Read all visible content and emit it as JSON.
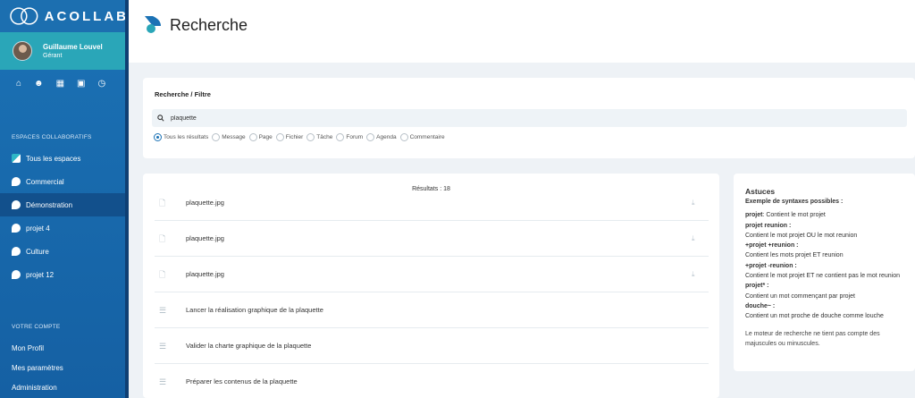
{
  "sidebar": {
    "brand": "ACOLLAB",
    "user": {
      "name": "Guillaume Louvel",
      "role": "Gérant"
    },
    "quick_icons": [
      "home-icon",
      "users-icon",
      "calendar-icon",
      "briefcase-icon",
      "clock-icon"
    ],
    "spaces_title": "ESPACES COLLABORATIFS",
    "spaces": [
      {
        "label": "Tous les espaces",
        "icon": "spaces-icon"
      },
      {
        "label": "Commercial",
        "icon": "space-icon"
      },
      {
        "label": "Démonstration",
        "icon": "space-icon",
        "active": true
      },
      {
        "label": "projet 4",
        "icon": "space-icon"
      },
      {
        "label": "Culture",
        "icon": "space-icon"
      },
      {
        "label": "projet 12",
        "icon": "space-icon"
      }
    ],
    "account_title": "VOTRE COMPTE",
    "account": [
      {
        "label": "Mon Profil"
      },
      {
        "label": "Mes paramètres"
      },
      {
        "label": "Administration"
      }
    ]
  },
  "header": {
    "title": "Recherche"
  },
  "search": {
    "title": "Recherche / Filtre",
    "value": "plaquette",
    "filters": [
      {
        "label": "Tous les résultats",
        "selected": true
      },
      {
        "label": "Message"
      },
      {
        "label": "Page"
      },
      {
        "label": "Fichier"
      },
      {
        "label": "Tâche"
      },
      {
        "label": "Forum"
      },
      {
        "label": "Agenda"
      },
      {
        "label": "Commentaire"
      }
    ]
  },
  "results": {
    "count_text": "Résultats : 18",
    "items": [
      {
        "label": "plaquette.jpg",
        "type": "file"
      },
      {
        "label": "plaquette.jpg",
        "type": "file"
      },
      {
        "label": "plaquette.jpg",
        "type": "file"
      },
      {
        "label": "Lancer la réalisation graphique de la plaquette",
        "type": "task"
      },
      {
        "label": "Valider la charte graphique de la plaquette",
        "type": "task"
      },
      {
        "label": "Préparer les contenus de la plaquette",
        "type": "task"
      }
    ]
  },
  "tips": {
    "title": "Astuces",
    "subtitle": "Exemple de syntaxes possibles :",
    "examples": [
      {
        "term": "projet",
        "sep": ": ",
        "desc": "Contient le mot projet"
      },
      {
        "term": "projet reunion :",
        "sep": "",
        "desc": "Contient le mot projet OU le mot reunion"
      },
      {
        "term": "+projet +reunion :",
        "sep": "",
        "desc": "Contient les mots projet ET reunion"
      },
      {
        "term": "+projet -reunion :",
        "sep": "",
        "desc": "Contient le mot projet ET ne contient pas le mot reunion"
      },
      {
        "term": "projet* :",
        "sep": "",
        "desc": "Contient un mot commençant par projet"
      },
      {
        "term": "douche~ :",
        "sep": "",
        "desc": "Contient un mot proche de douche comme louche"
      }
    ],
    "note": "Le moteur de recherche ne tient pas compte des majuscules ou minuscules."
  }
}
